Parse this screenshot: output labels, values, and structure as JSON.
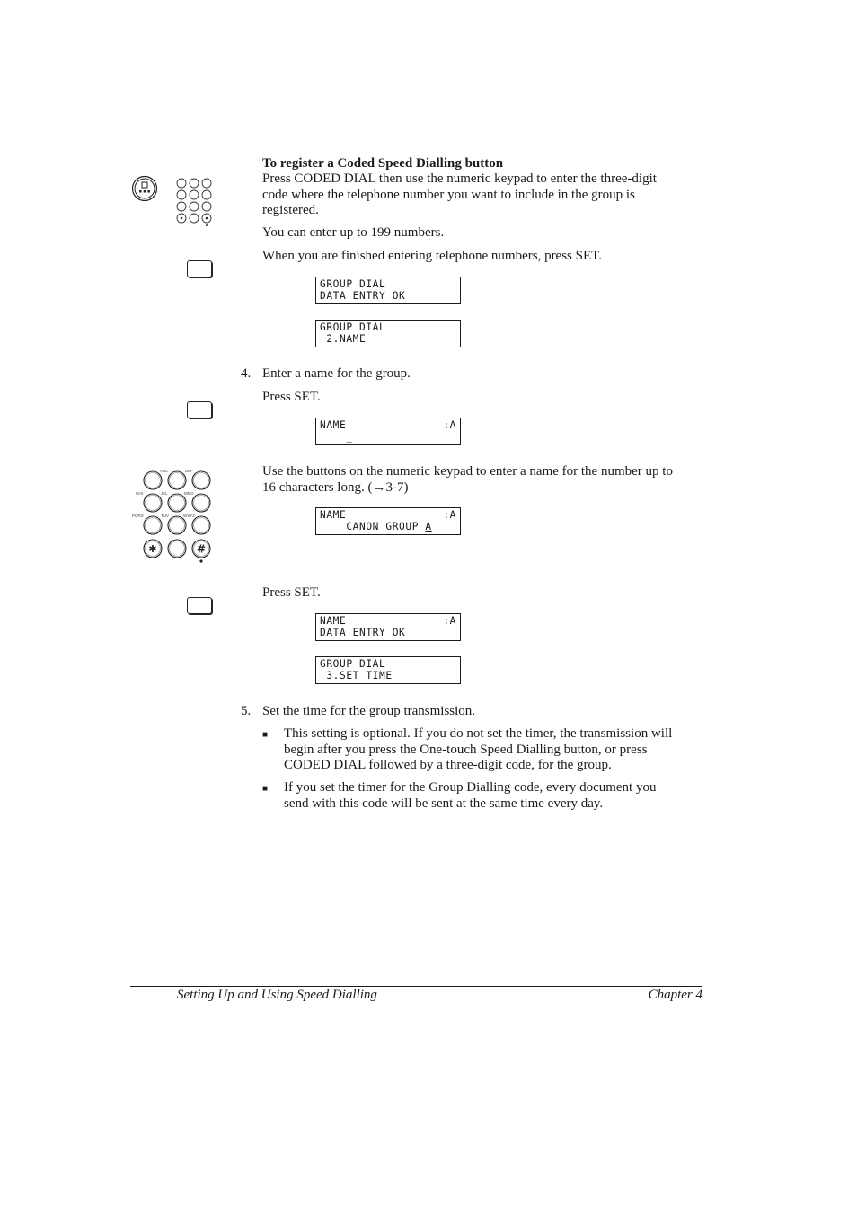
{
  "section_heading": "To register a Coded Speed Dialling button",
  "paragraphs": {
    "p1": [
      "Press CODED DIAL then use the numeric keypad to enter the three-digit",
      "code where the telephone number you want to include in the group is",
      "registered."
    ],
    "p2": "You can enter up to 199 numbers.",
    "p3": "When you are finished entering telephone numbers, press SET."
  },
  "lcd_displays": [
    {
      "line1": "GROUP DIAL",
      "line1_right": "",
      "line2": "DATA ENTRY OK"
    },
    {
      "line1": "GROUP DIAL",
      "line1_right": "",
      "line2": " 2.NAME"
    },
    {
      "line1": "NAME",
      "line1_right": ":A",
      "line2_prefix": "    ",
      "line2_cursor": "_"
    },
    {
      "line1": "NAME",
      "line1_right": ":A",
      "line2_prefix": "    CANON GROUP ",
      "line2_cursor": "A"
    },
    {
      "line1": "NAME",
      "line1_right": ":A",
      "line2": "DATA ENTRY OK"
    },
    {
      "line1": "GROUP DIAL",
      "line1_right": "",
      "line2": " 3.SET TIME"
    }
  ],
  "steps": {
    "step4": {
      "number": "4.",
      "text": "Enter a name for the group.",
      "press_set": "Press SET.",
      "keypad_text": [
        "Use the buttons on the numeric keypad to enter a name for the number up to",
        "16 characters long. (→3-7)"
      ],
      "press_set_2": "Press SET."
    },
    "step5": {
      "number": "5.",
      "text": "Set the time for the group transmission.",
      "bullets": [
        [
          "This setting is optional. If you do not set the timer, the transmission will",
          "begin after you press the One-touch Speed Dialling button, or press",
          "CODED DIAL followed by a three-digit code, for the group."
        ],
        [
          "If you set the timer for the Group Dialling code, every document you",
          "send with this code will be sent at the same time every day."
        ]
      ],
      "bullet_glyph": "■"
    }
  },
  "keypad": {
    "letters": [
      "",
      "ABC",
      "DEF",
      "GHI",
      "JKL",
      "MNO",
      "PQRS",
      "TUV",
      "WXYZ"
    ],
    "star": "✱",
    "hash": "#"
  },
  "footer": {
    "left": "Setting Up and Using Speed Dialling",
    "right": "Chapter 4"
  }
}
